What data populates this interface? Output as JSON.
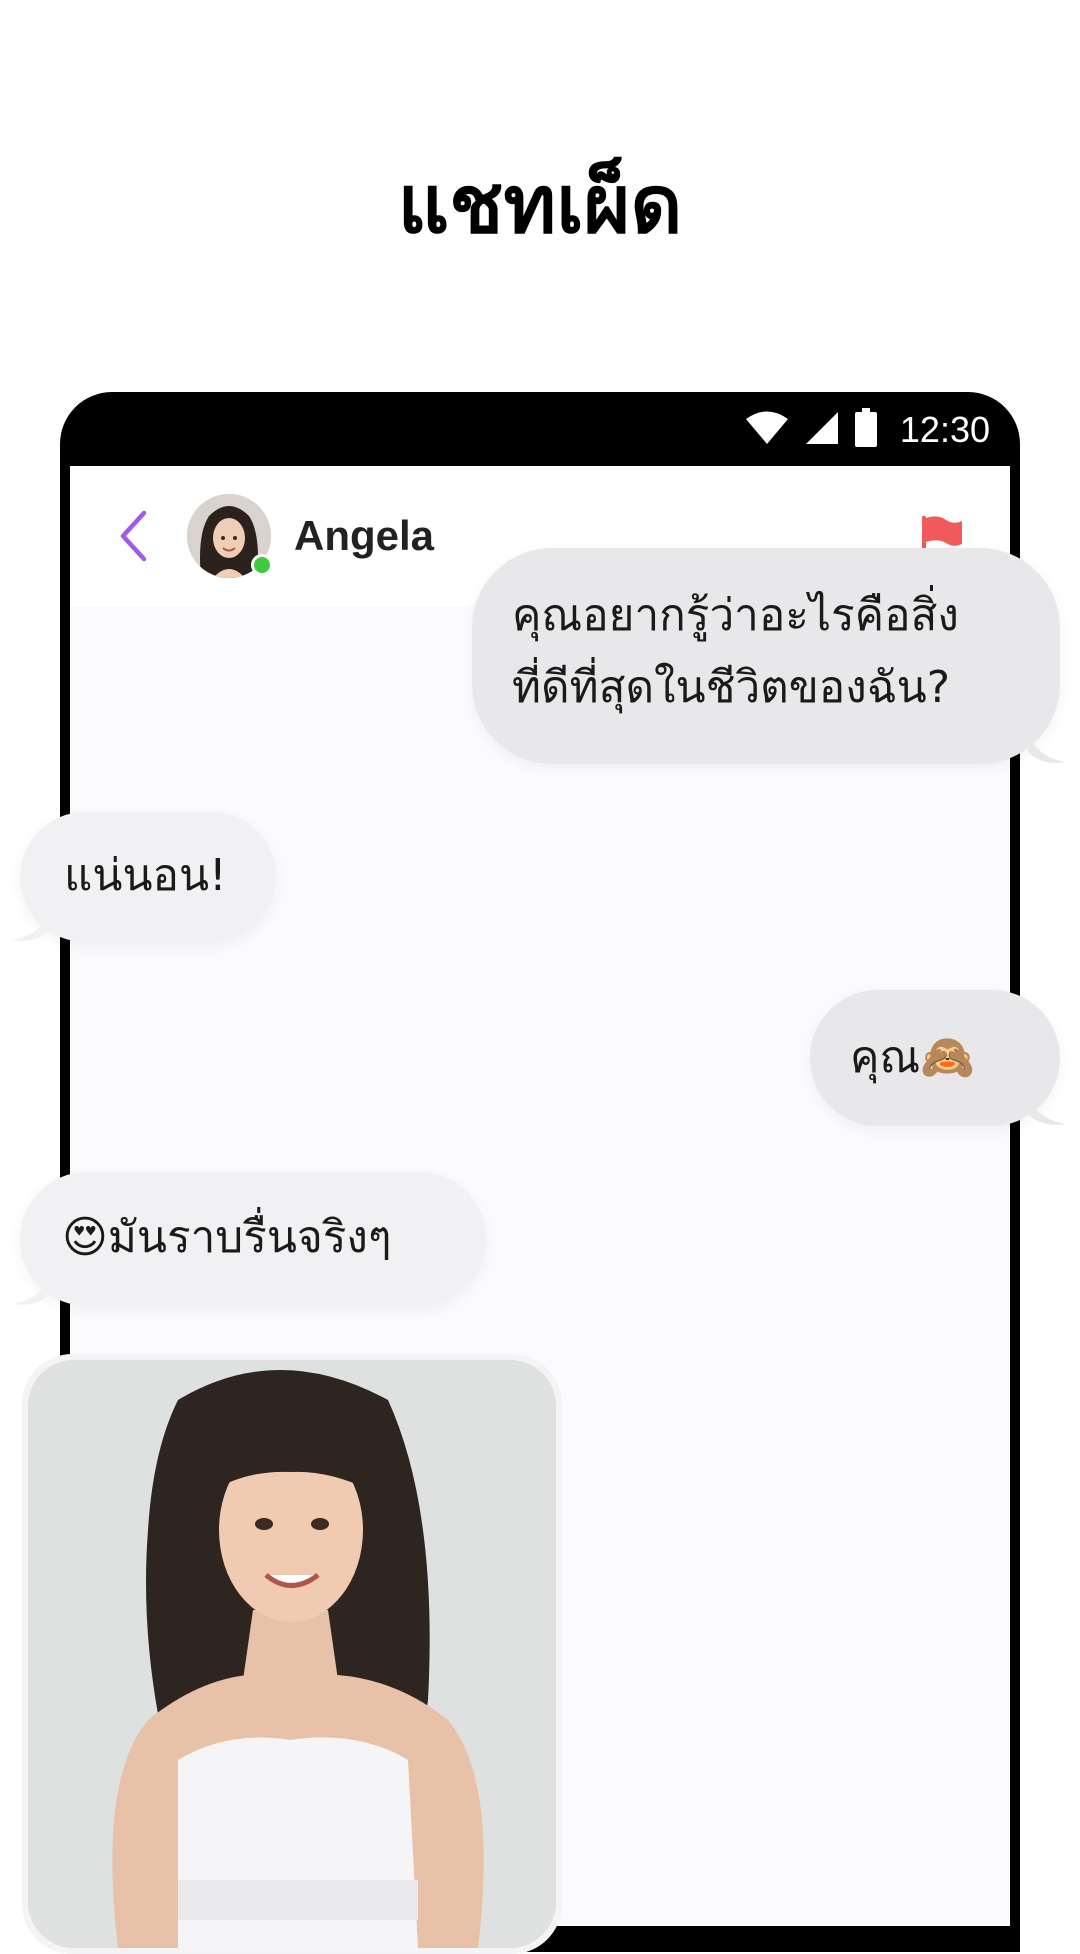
{
  "headline": "แชทเผ็ด",
  "status_bar": {
    "time": "12:30",
    "icons": [
      "wifi-icon",
      "signal-icon",
      "battery-icon"
    ]
  },
  "chat_header": {
    "contact_name": "Angela",
    "online": true,
    "back_icon": "chevron-left-icon",
    "report_icon": "flag-icon"
  },
  "messages": [
    {
      "direction": "outgoing",
      "lines": [
        "คุณอยากรู้ว่าอะไรคือสิ่ง",
        "ที่ดีที่สุดในชีวิตของฉัน?"
      ]
    },
    {
      "direction": "incoming",
      "text": "แน่นอน!"
    },
    {
      "direction": "outgoing",
      "text": "คุณ",
      "emoji": "🙈"
    },
    {
      "direction": "incoming",
      "emoji": "😍",
      "text": "มันราบรื่นจริงๆ"
    },
    {
      "direction": "incoming",
      "type": "photo",
      "content": "photo-of-woman"
    }
  ],
  "colors": {
    "accent": "#a259e6",
    "report": "#f05a5a",
    "online": "#3ccb3c",
    "bubble": "#e8e8ea"
  }
}
